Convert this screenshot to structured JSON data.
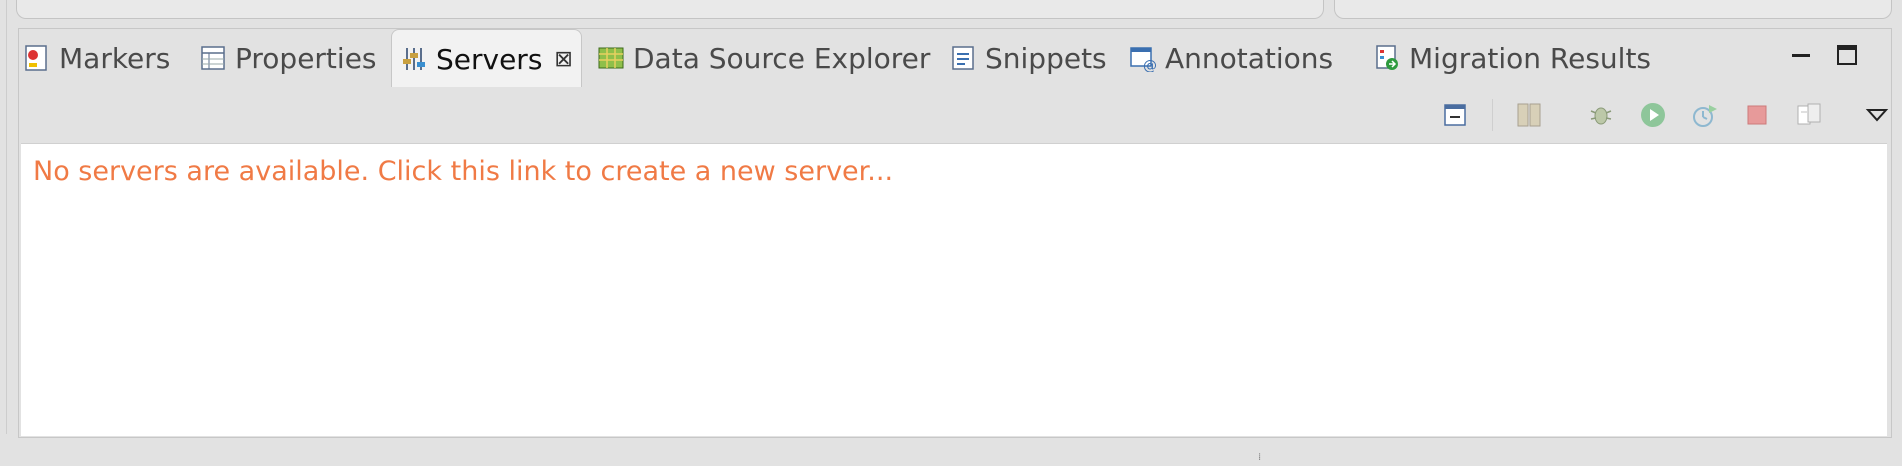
{
  "tabs": [
    {
      "name": "Markers",
      "icon": "markers-icon"
    },
    {
      "name": "Properties",
      "icon": "properties-icon"
    },
    {
      "name": "Servers",
      "icon": "servers-icon",
      "active": true
    },
    {
      "name": "Data Source Explorer",
      "icon": "data-source-explorer-icon"
    },
    {
      "name": "Snippets",
      "icon": "snippets-icon"
    },
    {
      "name": "Annotations",
      "icon": "annotations-icon"
    },
    {
      "name": "Migration Results",
      "icon": "migration-results-icon"
    }
  ],
  "content": {
    "message": "No servers are available. Click this link to create a new server..."
  },
  "colors": {
    "link": "#f07a45",
    "panel_bg": "#e2e2e2",
    "content_bg": "#ffffff"
  },
  "toolbar_icons": [
    "collapse-all-icon",
    "new-server-icon",
    "debug-server-icon",
    "start-server-icon",
    "profile-server-icon",
    "stop-server-icon",
    "publish-server-icon",
    "view-menu-icon"
  ]
}
